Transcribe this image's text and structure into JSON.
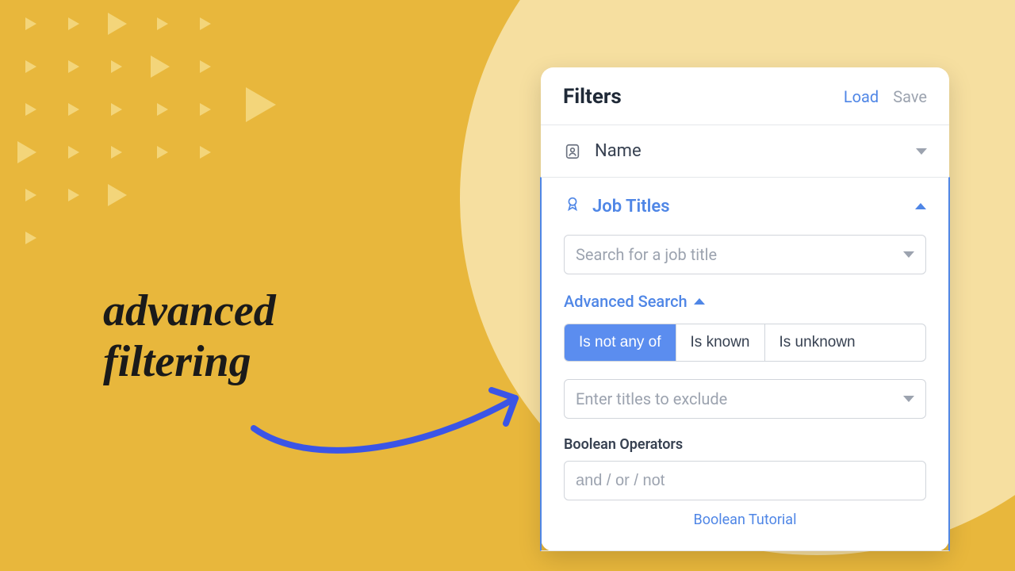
{
  "callout": "advanced\nfiltering",
  "panel": {
    "title": "Filters",
    "load_label": "Load",
    "save_label": "Save",
    "name_filter": {
      "label": "Name"
    },
    "job_titles": {
      "label": "Job Titles",
      "search_placeholder": "Search for a job title",
      "advanced_toggle": "Advanced Search",
      "segments": [
        "Is not any of",
        "Is known",
        "Is unknown"
      ],
      "active_segment_index": 0,
      "exclude_placeholder": "Enter titles to exclude",
      "boolean_label": "Boolean Operators",
      "boolean_placeholder": "and / or / not",
      "tutorial_link": "Boolean Tutorial"
    }
  },
  "colors": {
    "accent": "#4f86e6",
    "bg": "#e8b73c",
    "blob": "#f6dfa0"
  }
}
